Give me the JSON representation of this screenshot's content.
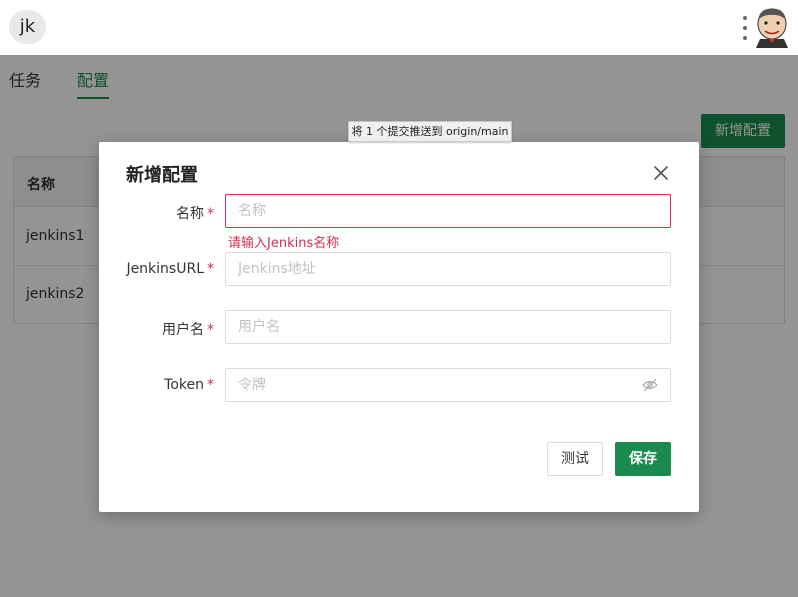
{
  "header": {
    "avatar_text": "jk",
    "logo_icon": "jenkins-butler-icon",
    "menu_icon": "kebab-menu-icon"
  },
  "tabs": [
    {
      "label": "任务",
      "active": false
    },
    {
      "label": "配置",
      "active": true
    }
  ],
  "toolbar": {
    "add_button": "新增配置"
  },
  "table": {
    "header": "名称",
    "rows": [
      "jenkins1",
      "jenkins2"
    ]
  },
  "tooltip": {
    "text": "将 1 个提交推送到 origin/main"
  },
  "dialog": {
    "title": "新增配置",
    "fields": {
      "name": {
        "label": "名称",
        "placeholder": "名称",
        "error": "请输入Jenkins名称"
      },
      "url": {
        "label": "JenkinsURL",
        "placeholder": "Jenkins地址"
      },
      "user": {
        "label": "用户名",
        "placeholder": "用户名"
      },
      "token": {
        "label": "Token",
        "placeholder": "令牌"
      }
    },
    "required_mark": "*",
    "test_button": "测试",
    "save_button": "保存"
  },
  "colors": {
    "primary": "#1b8a4f",
    "error": "#d03050"
  }
}
